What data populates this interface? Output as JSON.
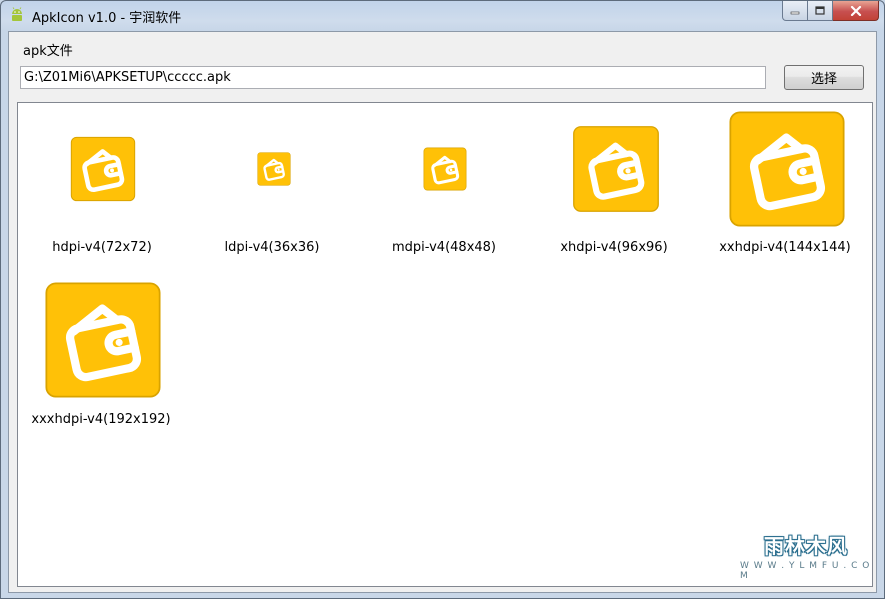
{
  "window": {
    "title": "ApkIcon v1.0 - 宇润软件",
    "minimize_label": "minimize",
    "maximize_label": "maximize",
    "close_label": "close"
  },
  "form": {
    "group_label": "apk文件",
    "path_value": "G:\\Z01Mi6\\APKSETUP\\ccccc.apk",
    "select_button_label": "选择"
  },
  "icons": [
    {
      "label": "hdpi-v4(72x72)",
      "icon": "wallet-icon"
    },
    {
      "label": "ldpi-v4(36x36)",
      "icon": "wallet-icon"
    },
    {
      "label": "mdpi-v4(48x48)",
      "icon": "wallet-icon"
    },
    {
      "label": "xhdpi-v4(96x96)",
      "icon": "wallet-icon"
    },
    {
      "label": "xxhdpi-v4(144x144)",
      "icon": "wallet-icon"
    },
    {
      "label": "xxxhdpi-v4(192x192)",
      "icon": "wallet-icon"
    }
  ],
  "watermark": {
    "main": "雨林木风",
    "sub": "W W W . Y L M F U . C O M"
  },
  "colors": {
    "icon_background": "#FFC107",
    "icon_border": "#D9A300",
    "selection_blue": "#3399ff"
  }
}
